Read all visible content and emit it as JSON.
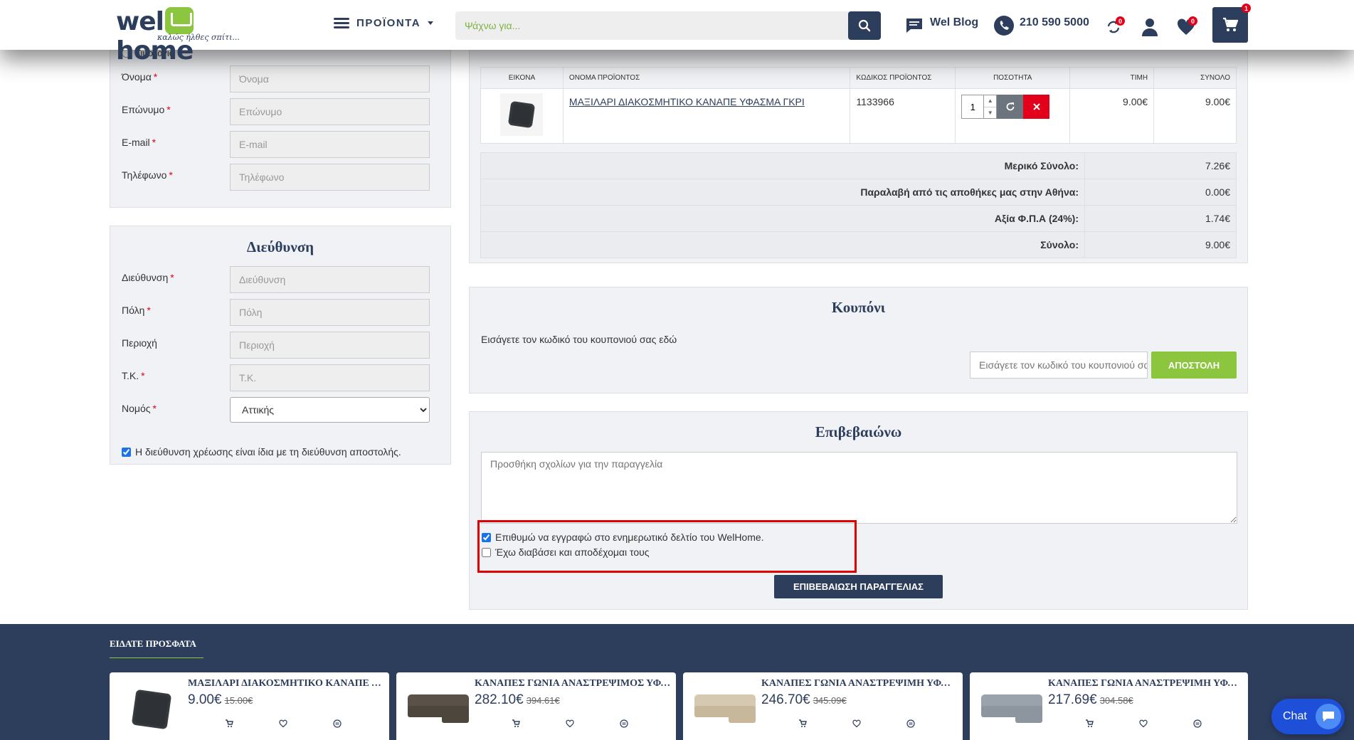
{
  "header": {
    "logo_word_left": "wel",
    "logo_word_right": "home",
    "logo_slogan": "καλώς ήλθες σπίτι...",
    "products_menu": "ΠΡΟΪΟΝΤΑ",
    "search_placeholder": "Ψάχνω για...",
    "blog_label": "Wel Blog",
    "phone": "210 590 5000",
    "compare_count": "0",
    "wishlist_count": "0",
    "cart_count": "1"
  },
  "customer": {
    "invoice_option": "Τιμολόγιο",
    "fields": [
      {
        "label": "Όνομα",
        "placeholder": "Όνομα",
        "required": true
      },
      {
        "label": "Επώνυμο",
        "placeholder": "Επώνυμο",
        "required": true
      },
      {
        "label": "E-mail",
        "placeholder": "E-mail",
        "required": true
      },
      {
        "label": "Τηλέφωνο",
        "placeholder": "Τηλέφωνο",
        "required": true
      }
    ],
    "required_mark": "*"
  },
  "address": {
    "title": "Διεύθυνση",
    "fields": [
      {
        "label": "Διεύθυνση",
        "placeholder": "Διεύθυνση"
      },
      {
        "label": "Πόλη",
        "placeholder": "Πόλη"
      },
      {
        "label": "Περιοχή",
        "placeholder": "Περιοχή"
      },
      {
        "label": "Τ.Κ.",
        "placeholder": "Τ.Κ."
      }
    ],
    "prefecture_label": "Νομός",
    "prefecture_value": "Αττικής",
    "same_billing_label": "Η διεύθυνση χρέωσης είναι ίδια με τη διεύθυνση αποστολής."
  },
  "cart": {
    "columns": [
      "ΕΙΚΟΝΑ",
      "ΟΝΟΜΑ ΠΡΟΪΟΝΤΟΣ",
      "ΚΩΔΙΚΟΣ ΠΡΟΪΟΝΤΟΣ",
      "ΠΟΣΟΤΗΤΑ",
      "ΤΙΜΗ",
      "ΣΥΝΟΛΟ"
    ],
    "item": {
      "name": "ΜΑΞΙΛΑΡΙ ΔΙΑΚΟΣΜΗΤΙΚΟ ΚΑΝΑΠΕ ΥΦΑΣΜΑ ΓΚΡΙ",
      "code": "1133966",
      "quantity": "1",
      "price": "9.00€",
      "total": "9.00€"
    },
    "totals": [
      {
        "label": "Μερικό Σύνολο:",
        "value": "7.26€"
      },
      {
        "label": "Παραλαβή από τις αποθήκες μας στην Αθήνα:",
        "value": "0.00€"
      },
      {
        "label": "Αξία Φ.Π.Α (24%):",
        "value": "1.74€"
      },
      {
        "label": "Σύνολο:",
        "value": "9.00€"
      }
    ]
  },
  "coupon": {
    "title": "Κουπόνι",
    "description": "Εισάγετε τον κωδικό του κουπονιού σας εδώ",
    "input_placeholder": "Εισάγετε τον κωδικό του κουπονιού σας",
    "submit_label": "ΑΠΟΣΤΟΛΗ"
  },
  "confirm": {
    "title": "Επιβεβαιώνω",
    "comments_placeholder": "Προσθήκη σχολίων για την παραγγελία",
    "newsletter_label": "Επιθυμώ να εγγραφώ στο ενημερωτικό δελτίο του WelHome.",
    "newsletter_checked": true,
    "terms_label": "Έχω διαβάσει και αποδέχομαι τους",
    "terms_checked": false,
    "submit_label": "ΕΠΙΒΕΒΑΙΩΣΗ ΠΑΡΑΓΓΕΛΙΑΣ"
  },
  "recent": {
    "title": "ΕΙΔΑΤΕ ΠΡΟΣΦΑΤΑ",
    "items": [
      {
        "name": "ΜΑΞΙΛΑΡΙ ΔΙΑΚΟΣΜΗΤΙΚΟ ΚΑΝΑΠΕ ΥΦΑΣΜΑ ΓΚΡΙ",
        "price": "9.00€",
        "old_price": "15.00€",
        "color": "#2e3236"
      },
      {
        "name": "ΚΑΝΑΠΕΣ ΓΩΝΙΑ ΑΝΑΣΤΡΕΨΙΜΟΣ ΥΦΑΣΜΑ",
        "price": "282.10€",
        "old_price": "394.61€",
        "color": "#5a5248"
      },
      {
        "name": "ΚΑΝΑΠΕΣ ΓΩΝΙΑ ΑΝΑΣΤΡΕΨΙΜΗ ΥΦΑΣΜΑ",
        "price": "246.70€",
        "old_price": "345.09€",
        "color": "#cdbfa6"
      },
      {
        "name": "ΚΑΝΑΠΕΣ ΓΩΝΙΑ ΑΝΑΣΤΡΕΨΙΜΗ ΥΦΑΣΜΑ",
        "price": "217.69€",
        "old_price": "304.58€",
        "color": "#8d959e"
      }
    ]
  },
  "chat": {
    "label": "Chat"
  },
  "colors": {
    "navy": "#2d3e5d",
    "green": "#8cc63f",
    "red": "#e3001b",
    "highlight_box": "#e00000"
  }
}
